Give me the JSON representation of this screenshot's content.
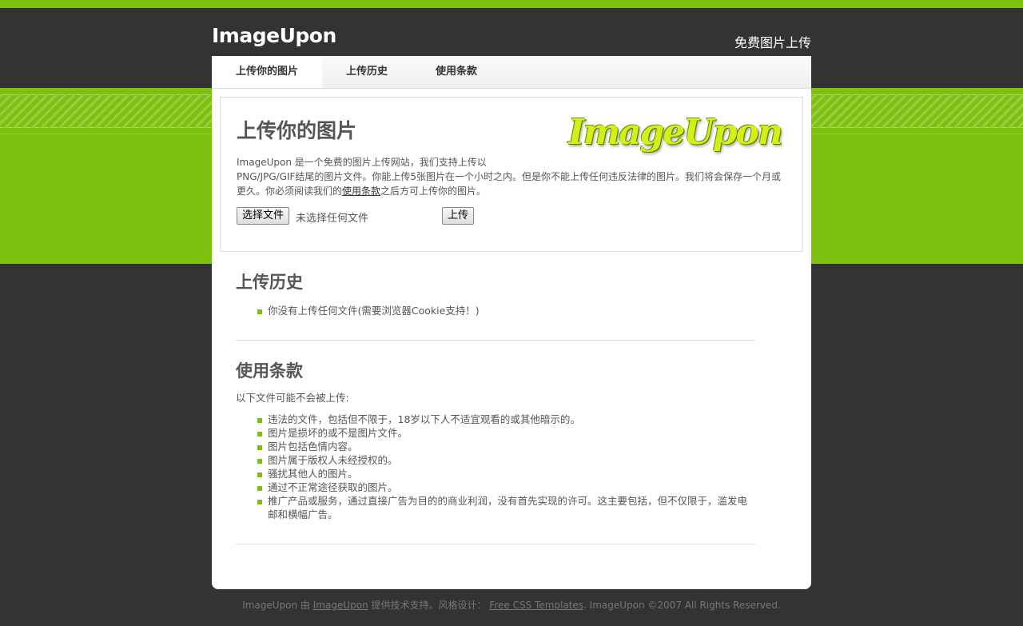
{
  "header": {
    "title": "ImageUpon",
    "slogan": "免费图片上传"
  },
  "nav": {
    "tabs": [
      {
        "label": "上传你的图片"
      },
      {
        "label": "上传历史"
      },
      {
        "label": "使用条款"
      }
    ]
  },
  "upload": {
    "title": "上传你的图片",
    "logo_text": "ImageUpon",
    "intro_brand": "ImageUpon",
    "intro_part1": " 是一个免费的图片上传网站，我们支持上传以",
    "intro_part2": "PNG/JPG/GIF结尾的图片文件。你能上传5张图片在一个小时之内。但是你不能上传任何违反法律的图片。我们将会保存一个月或更久。你必须阅读我们的",
    "intro_link": "使用条款",
    "intro_part3": "之后方可上传你的图片。",
    "choose_file_label": "选择文件",
    "no_file_label": "未选择任何文件",
    "submit_label": "上传"
  },
  "history": {
    "title": "上传历史",
    "items": [
      "你没有上传任何文件(需要浏览器Cookie支持！)"
    ]
  },
  "terms": {
    "title": "使用条款",
    "intro": "以下文件可能不会被上传:",
    "items": [
      "违法的文件，包括但不限于，18岁以下人不适宜观看的或其他暗示的。",
      "图片是损坏的或不是图片文件。",
      "图片包括色情内容。",
      "图片属于版权人未经授权的。",
      "骚扰其他人的图片。",
      "通过不正常途径获取的图片。",
      "推广产品或服务，通过直接广告为目的的商业利润，没有首先实现的许可。这主要包括，但不仅限于，滥发电邮和横幅广告。"
    ]
  },
  "footer": {
    "prefix": "ImageUpon 由 ",
    "link1": "ImageUpon",
    "middle": " 提供技术支持。风格设计： ",
    "link2": "Free CSS Templates",
    "suffix": ". ImageUpon ©2007 All Rights Reserved."
  },
  "colors": {
    "accent_green": "#7dc00d",
    "background_dark": "#333333",
    "logo_yellow": "#d4ee1a"
  }
}
